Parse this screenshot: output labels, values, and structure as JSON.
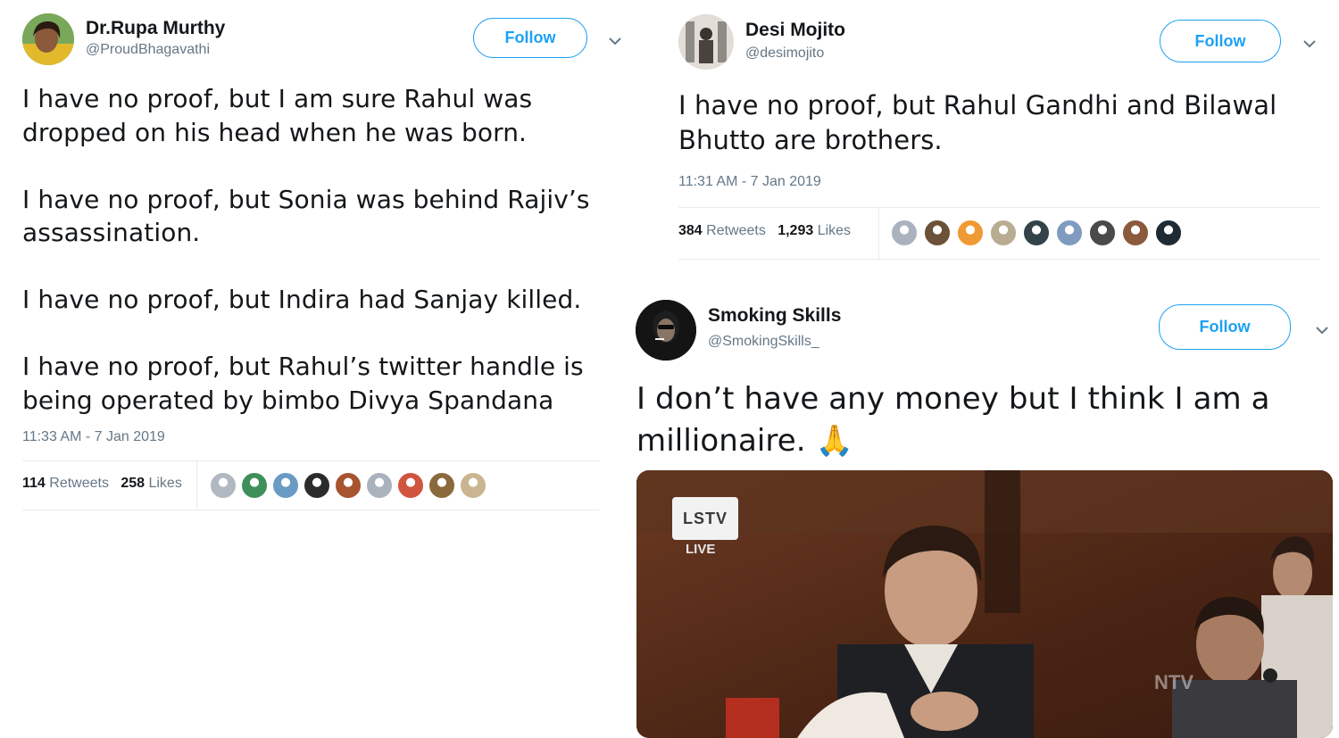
{
  "tweets": [
    {
      "name": "Dr.Rupa Murthy",
      "handle": "@ProudBhagavathi",
      "follow_label": "Follow",
      "text": "I have no proof, but I am sure Rahul was\ndropped on his head when he was born.\n\nI have no proof, but Sonia was behind Rajiv’s\nassassination.\n\nI have no proof, but Indira had Sanjay killed.\n\nI have no proof, but Rahul’s twitter handle is\nbeing operated by bimbo Divya Spandana",
      "timestamp": "11:33 AM - 7 Jan 2019",
      "retweets_count": "114",
      "retweets_label": "Retweets",
      "likes_count": "258",
      "likes_label": "Likes",
      "liker_colors": [
        "#b0b8c1",
        "#3f8f5a",
        "#6a9bc4",
        "#2b2b2b",
        "#a8542e",
        "#aab3bd",
        "#d0553f",
        "#8a6a3c",
        "#c9b590"
      ]
    },
    {
      "name": "Desi Mojito",
      "handle": "@desimojito",
      "follow_label": "Follow",
      "text": "I have no proof, but Rahul Gandhi and Bilawal\nBhutto are brothers.",
      "timestamp": "11:31 AM - 7 Jan 2019",
      "retweets_count": "384",
      "retweets_label": "Retweets",
      "likes_count": "1,293",
      "likes_label": "Likes",
      "liker_colors": [
        "#aab3bd",
        "#6b5137",
        "#f09a34",
        "#b8ad92",
        "#33434a",
        "#7f9bc0",
        "#4a4a4a",
        "#8b5a3c",
        "#1f2a33"
      ]
    },
    {
      "name": "Smoking Skills",
      "handle": "@SmokingSkills_",
      "follow_label": "Follow",
      "text": "I don’t have any money but I think I am a\nmillionaire. 🙏",
      "media": {
        "channel_logo": "LSTV",
        "live_label": "LIVE",
        "watermark": "NTV"
      }
    }
  ],
  "colors": {
    "accent": "#1da1f2",
    "meta_gray": "#657786",
    "divider": "#e6ecf0"
  }
}
